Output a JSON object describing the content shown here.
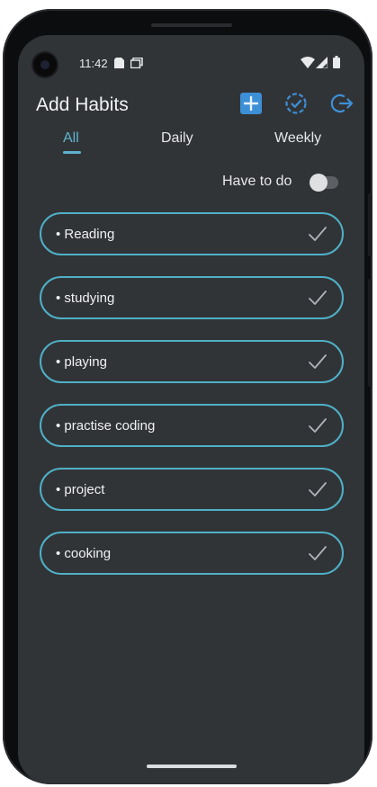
{
  "status": {
    "time": "11:42"
  },
  "header": {
    "title": "Add Habits"
  },
  "tabs": [
    {
      "label": "All"
    },
    {
      "label": "Daily"
    },
    {
      "label": "Weekly"
    }
  ],
  "filter": {
    "label": "Have to do",
    "enabled": false
  },
  "habits": [
    {
      "label": "• Reading"
    },
    {
      "label": "• studying"
    },
    {
      "label": "• playing"
    },
    {
      "label": "• practise coding"
    },
    {
      "label": "• project"
    },
    {
      "label": "• cooking"
    }
  ],
  "colors": {
    "background": "#313437",
    "accent": "#5fb3cf",
    "card_border": "#4fb0c6",
    "icon_blue": "#3d8fd6"
  },
  "icons": [
    "add-square-icon",
    "check-circle-icon",
    "logout-icon",
    "check-icon"
  ]
}
